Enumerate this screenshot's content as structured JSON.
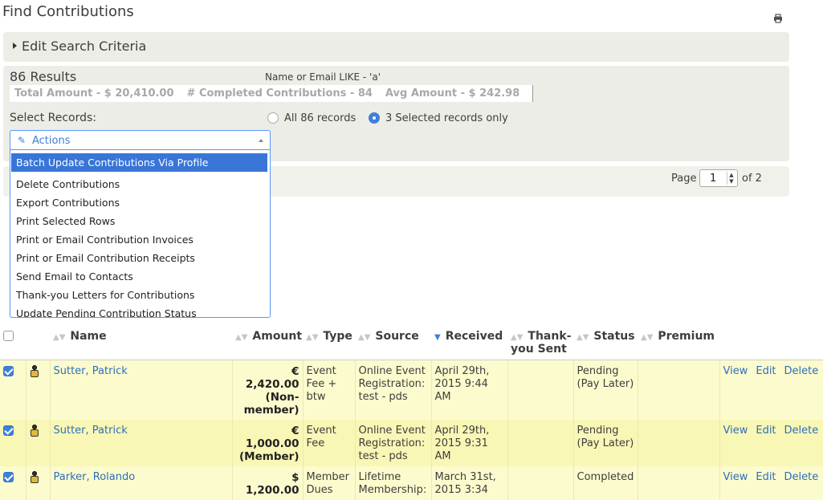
{
  "page": {
    "title": "Find Contributions"
  },
  "criteria": {
    "label": "Edit Search Criteria"
  },
  "results": {
    "count": "86 Results",
    "qill": "Name or Email LIKE - 'a'",
    "total_amount": "Total Amount - $ 20,410.00",
    "completed": "# Completed Contributions - 84",
    "avg_amount": "Avg Amount - $ 242.98",
    "select_records_label": "Select Records:",
    "radio_all": "All 86 records",
    "radio_selected": "3 Selected records only",
    "radio_selected_checked": true
  },
  "actions": {
    "label": "Actions",
    "items": [
      "Batch Update Contributions Via Profile",
      "Delete Contributions",
      "Export Contributions",
      "Print Selected Rows",
      "Print or Email Contribution Invoices",
      "Print or Email Contribution Receipts",
      "Send Email to Contacts",
      "Thank-you Letters for Contributions",
      "Update Pending Contribution Status"
    ],
    "highlighted_index": 0
  },
  "pager": {
    "page_label": "Page",
    "current_page": "1",
    "of_label": "of 2"
  },
  "table": {
    "headers": {
      "name": "Name",
      "amount": "Amount",
      "type": "Type",
      "source": "Source",
      "received": "Received",
      "thankyou": "Thank-you Sent",
      "status": "Status",
      "premium": "Premium"
    },
    "rows": [
      {
        "name": "Sutter, Patrick",
        "amount": "€ 2,420.00 (Non-member)",
        "type": "Event Fee + btw",
        "source": "Online Event Registration: test - pds",
        "received": "April 29th, 2015 9:44 AM",
        "thankyou": "",
        "status": "Pending (Pay Later)",
        "premium": "",
        "view": "View",
        "edit": "Edit",
        "delete": "Delete"
      },
      {
        "name": "Sutter, Patrick",
        "amount": "€ 1,000.00 (Member)",
        "type": "Event Fee",
        "source": "Online Event Registration: test - pds",
        "received": "April 29th, 2015 9:31 AM",
        "thankyou": "",
        "status": "Pending (Pay Later)",
        "premium": "",
        "view": "View",
        "edit": "Edit",
        "delete": "Delete"
      },
      {
        "name": "Parker, Rolando",
        "amount": "$ 1,200.00",
        "type": "Member Dues",
        "source": "Lifetime Membership:",
        "received": "March 31st, 2015 3:34",
        "thankyou": "",
        "status": "Completed",
        "premium": "",
        "view": "View",
        "edit": "Edit",
        "delete": "Delete"
      }
    ]
  }
}
